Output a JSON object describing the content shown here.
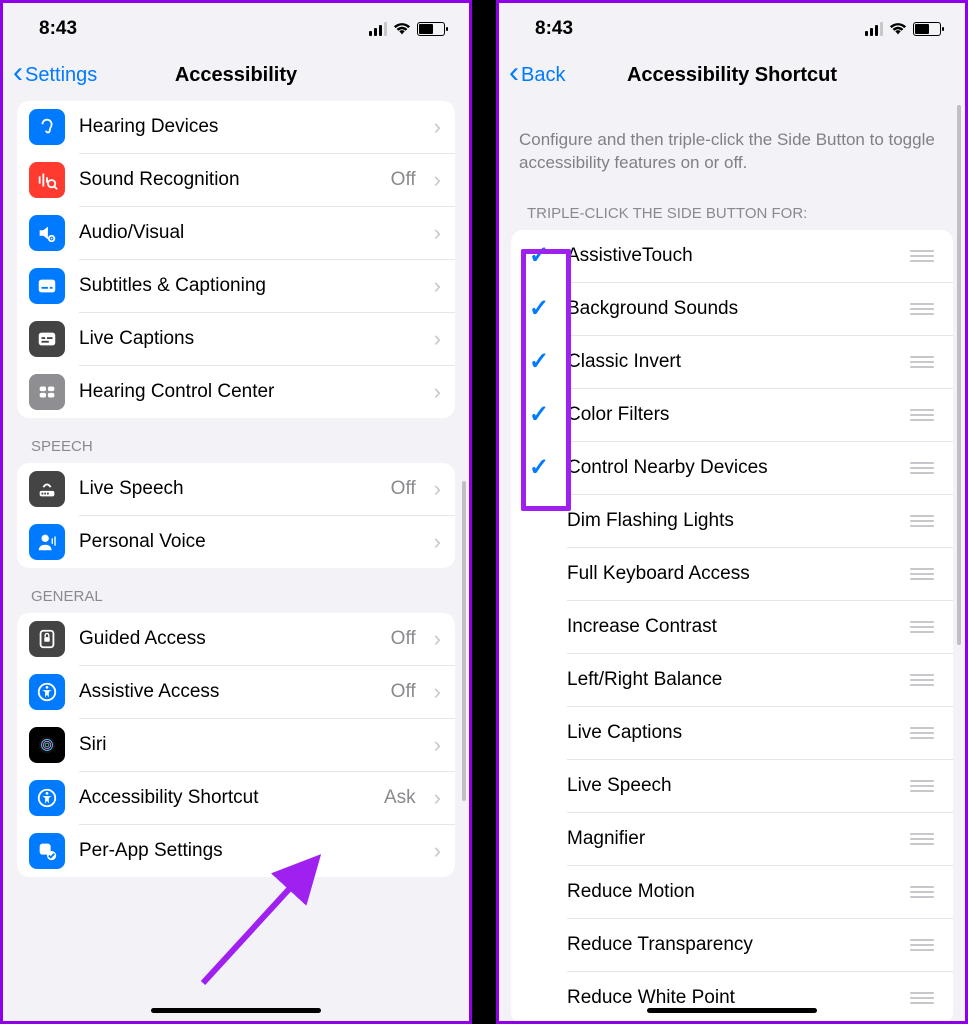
{
  "status": {
    "time": "8:43"
  },
  "left": {
    "back_label": "Settings",
    "title": "Accessibility",
    "sections": [
      {
        "header": null,
        "rows": [
          {
            "icon": "ear-icon",
            "color": "#007aff",
            "label": "Hearing Devices",
            "detail": ""
          },
          {
            "icon": "sound-recognition-icon",
            "color": "#ff3b30",
            "label": "Sound Recognition",
            "detail": "Off"
          },
          {
            "icon": "audio-visual-icon",
            "color": "#007aff",
            "label": "Audio/Visual",
            "detail": ""
          },
          {
            "icon": "subtitles-icon",
            "color": "#007aff",
            "label": "Subtitles & Captioning",
            "detail": ""
          },
          {
            "icon": "live-captions-icon",
            "color": "#444",
            "label": "Live Captions",
            "detail": ""
          },
          {
            "icon": "hearing-control-icon",
            "color": "#8e8e93",
            "label": "Hearing Control Center",
            "detail": ""
          }
        ]
      },
      {
        "header": "SPEECH",
        "rows": [
          {
            "icon": "live-speech-icon",
            "color": "#444",
            "label": "Live Speech",
            "detail": "Off"
          },
          {
            "icon": "personal-voice-icon",
            "color": "#007aff",
            "label": "Personal Voice",
            "detail": ""
          }
        ]
      },
      {
        "header": "GENERAL",
        "rows": [
          {
            "icon": "guided-access-icon",
            "color": "#444",
            "label": "Guided Access",
            "detail": "Off"
          },
          {
            "icon": "assistive-access-icon",
            "color": "#007aff",
            "label": "Assistive Access",
            "detail": "Off"
          },
          {
            "icon": "siri-icon",
            "color": "#000",
            "label": "Siri",
            "detail": ""
          },
          {
            "icon": "accessibility-shortcut-icon",
            "color": "#007aff",
            "label": "Accessibility Shortcut",
            "detail": "Ask"
          },
          {
            "icon": "per-app-icon",
            "color": "#007aff",
            "label": "Per-App Settings",
            "detail": ""
          }
        ]
      }
    ]
  },
  "right": {
    "back_label": "Back",
    "title": "Accessibility Shortcut",
    "description": "Configure and then triple-click the Side Button to toggle accessibility features on or off.",
    "list_header": "TRIPLE-CLICK THE SIDE BUTTON FOR:",
    "items": [
      {
        "label": "AssistiveTouch",
        "checked": true
      },
      {
        "label": "Background Sounds",
        "checked": true
      },
      {
        "label": "Classic Invert",
        "checked": true
      },
      {
        "label": "Color Filters",
        "checked": true
      },
      {
        "label": "Control Nearby Devices",
        "checked": true
      },
      {
        "label": "Dim Flashing Lights",
        "checked": false
      },
      {
        "label": "Full Keyboard Access",
        "checked": false
      },
      {
        "label": "Increase Contrast",
        "checked": false
      },
      {
        "label": "Left/Right Balance",
        "checked": false
      },
      {
        "label": "Live Captions",
        "checked": false
      },
      {
        "label": "Live Speech",
        "checked": false
      },
      {
        "label": "Magnifier",
        "checked": false
      },
      {
        "label": "Reduce Motion",
        "checked": false
      },
      {
        "label": "Reduce Transparency",
        "checked": false
      },
      {
        "label": "Reduce White Point",
        "checked": false
      }
    ]
  }
}
